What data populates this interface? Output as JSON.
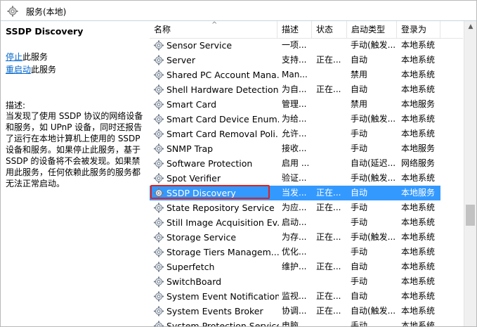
{
  "window": {
    "title": "服务(本地)"
  },
  "description_pane": {
    "service_name": "SSDP Discovery",
    "stop_link": "停止",
    "stop_suffix": "此服务",
    "restart_link": "重启动",
    "restart_suffix": "此服务",
    "desc_label": "描述:",
    "desc_text": "当发现了使用 SSDP 协议的网络设备和服务，如 UPnP 设备，同时还报告了运行在本地计算机上使用的 SSDP 设备和服务。如果停止此服务，基于 SSDP 的设备将不会被发现。如果禁用此服务，任何依赖此服务的服务都无法正常启动。"
  },
  "columns": {
    "name": "名称",
    "description": "描述",
    "status": "状态",
    "startup_type": "启动类型",
    "log_on_as": "登录为"
  },
  "services": [
    {
      "name": "Sensor Service",
      "description": "一项...",
      "status": "",
      "startup": "手动(触发...",
      "logon": "本地系统",
      "selected": false
    },
    {
      "name": "Server",
      "description": "支持...",
      "status": "正在...",
      "startup": "自动",
      "logon": "本地系统",
      "selected": false
    },
    {
      "name": "Shared PC Account Mana...",
      "description": "Man...",
      "status": "",
      "startup": "禁用",
      "logon": "本地系统",
      "selected": false
    },
    {
      "name": "Shell Hardware Detection",
      "description": "为自...",
      "status": "正在...",
      "startup": "自动",
      "logon": "本地系统",
      "selected": false
    },
    {
      "name": "Smart Card",
      "description": "管理...",
      "status": "",
      "startup": "禁用",
      "logon": "本地服务",
      "selected": false
    },
    {
      "name": "Smart Card Device Enum...",
      "description": "为给...",
      "status": "",
      "startup": "手动(触发...",
      "logon": "本地系统",
      "selected": false
    },
    {
      "name": "Smart Card Removal Poli...",
      "description": "允许...",
      "status": "",
      "startup": "手动",
      "logon": "本地系统",
      "selected": false
    },
    {
      "name": "SNMP Trap",
      "description": "接收...",
      "status": "",
      "startup": "手动",
      "logon": "本地服务",
      "selected": false
    },
    {
      "name": "Software Protection",
      "description": "启用 ...",
      "status": "",
      "startup": "自动(延迟...",
      "logon": "网络服务",
      "selected": false
    },
    {
      "name": "Spot Verifier",
      "description": "验证...",
      "status": "",
      "startup": "手动(触发...",
      "logon": "本地系统",
      "selected": false
    },
    {
      "name": "SSDP Discovery",
      "description": "当发...",
      "status": "正在...",
      "startup": "自动",
      "logon": "本地服务",
      "selected": true
    },
    {
      "name": "State Repository Service",
      "description": "为应...",
      "status": "正在...",
      "startup": "手动",
      "logon": "本地系统",
      "selected": false
    },
    {
      "name": "Still Image Acquisition Ev...",
      "description": "启动...",
      "status": "",
      "startup": "手动",
      "logon": "本地系统",
      "selected": false
    },
    {
      "name": "Storage Service",
      "description": "为存...",
      "status": "正在...",
      "startup": "手动(触发...",
      "logon": "本地系统",
      "selected": false
    },
    {
      "name": "Storage Tiers Managem...",
      "description": "优化...",
      "status": "",
      "startup": "手动",
      "logon": "本地系统",
      "selected": false
    },
    {
      "name": "Superfetch",
      "description": "维护...",
      "status": "正在...",
      "startup": "自动",
      "logon": "本地系统",
      "selected": false
    },
    {
      "name": "SwitchBoard",
      "description": "",
      "status": "",
      "startup": "手动",
      "logon": "本地系统",
      "selected": false
    },
    {
      "name": "System Event Notification...",
      "description": "监视...",
      "status": "正在...",
      "startup": "自动",
      "logon": "本地系统",
      "selected": false
    },
    {
      "name": "System Events Broker",
      "description": "协调...",
      "status": "正在...",
      "startup": "自动(触发...",
      "logon": "本地系统",
      "selected": false
    },
    {
      "name": "System Protection Service",
      "description": "电脑...",
      "status": "",
      "startup": "手动",
      "logon": "本地系统",
      "selected": false
    }
  ]
}
